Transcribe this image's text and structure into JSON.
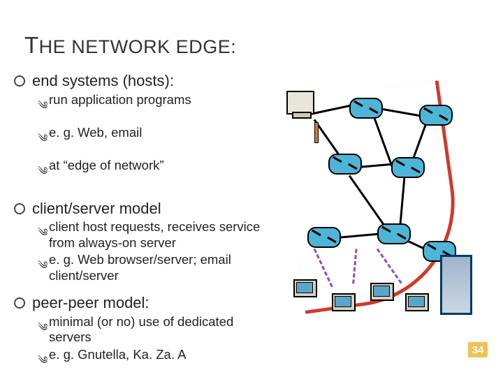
{
  "title_parts": {
    "t": "T",
    "he": "HE",
    "rest": " NETWORK EDGE:"
  },
  "page_number": "34",
  "sections": [
    {
      "heading": "end systems (hosts):",
      "items": [
        "run application programs",
        "e. g. Web, email",
        "at “edge of network”"
      ]
    },
    {
      "heading": "client/server model",
      "items": [
        "client host requests, receives service from always-on server",
        "e. g. Web browser/server; email client/server"
      ]
    },
    {
      "heading": "peer-peer model:",
      "items": [
        " minimal (or no) use of dedicated servers",
        "e. g. Gnutella, Ka. Za. A"
      ]
    }
  ]
}
